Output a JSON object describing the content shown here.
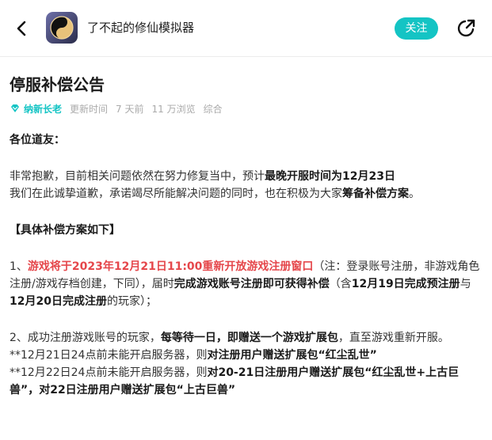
{
  "header": {
    "app_name": "了不起的修仙模拟器",
    "follow_label": "关注"
  },
  "article": {
    "title": "停服补偿公告",
    "author": "纳新长老",
    "update_label": "更新时间",
    "time": "7 天前",
    "views": "11 万浏览",
    "category": "综合"
  },
  "body": {
    "greeting": "各位道友：",
    "p1_a": "非常抱歉，目前相关问题依然在努力修复当中，预计",
    "p1_b": "最晚开服时间为12月23日",
    "p1_c": "我们在此诚挚道歉，承诺竭尽所能解决问题的同时，也在积极为大家",
    "p1_d": "筹备补偿方案",
    "p1_e": "。",
    "section": "【具体补偿方案如下】",
    "i1_a": "1、",
    "i1_b": "游戏将于2023年12月21日11:00重新开放游戏注册窗口",
    "i1_c": "（注：登录账号注册，非游戏角色注册/游戏存档创建，下同），届时",
    "i1_d": "完成游戏账号注册即可获得补偿",
    "i1_e": "（含",
    "i1_f": "12月19日完成预注册",
    "i1_g": "与",
    "i1_h": "12月20日完成注册",
    "i1_i": "的玩家）；",
    "i2_a": "2、成功注册游戏账号的玩家，",
    "i2_b": "每等待一日，即赠送一个游戏扩展包",
    "i2_c": "，直至游戏重新开服。",
    "n1_a": "**12月21日24点前未能开启服务器，则",
    "n1_b": "对注册用户赠送扩展包“红尘乱世”",
    "n2_a": "**12月22日24点前未能开启服务器，则",
    "n2_b": "对20-21日注册用户赠送扩展包“红尘乱世+上古巨兽”",
    "n2_c": "，",
    "n2_d": "对22日注册用户赠送扩展包“上古巨兽”"
  },
  "icons": {
    "back": "chevron-left-icon",
    "share": "share-icon",
    "author_badge": "diamond-badge-icon"
  },
  "colors": {
    "accent": "#14c4c4",
    "highlight_red": "#e5474b"
  }
}
